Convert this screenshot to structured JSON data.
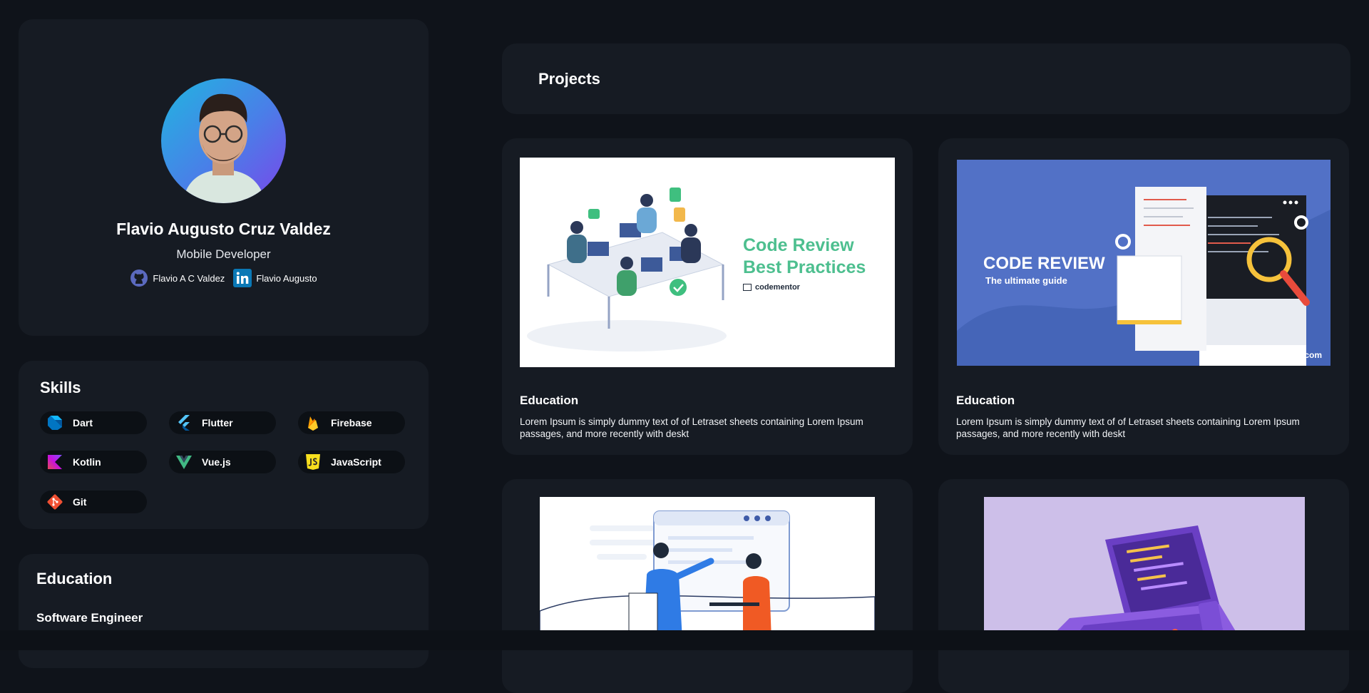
{
  "profile": {
    "name": "Flavio Augusto Cruz Valdez",
    "role": "Mobile Developer",
    "github_label": "Flavio A C Valdez",
    "linkedin_label": "Flavio Augusto"
  },
  "skills": {
    "title": "Skills",
    "items": [
      {
        "label": "Dart",
        "icon": "dart-icon"
      },
      {
        "label": "Flutter",
        "icon": "flutter-icon"
      },
      {
        "label": "Firebase",
        "icon": "firebase-icon"
      },
      {
        "label": "Kotlin",
        "icon": "kotlin-icon"
      },
      {
        "label": "Vue.js",
        "icon": "vue-icon"
      },
      {
        "label": "JavaScript",
        "icon": "javascript-icon"
      },
      {
        "label": "Git",
        "icon": "git-icon"
      }
    ]
  },
  "education": {
    "title": "Education",
    "degree": "Software Engineer"
  },
  "projects": {
    "title": "Projects",
    "items": [
      {
        "title": "Education",
        "description": "Lorem Ipsum is simply dummy text of of Letraset sheets containing Lorem Ipsum passages, and more recently with deskt",
        "thumb": {
          "heading1": "Code Review",
          "heading2": "Best Practices",
          "brand": "codementor"
        }
      },
      {
        "title": "Education",
        "description": "Lorem Ipsum is simply dummy text of of Letraset sheets containing Lorem Ipsum passages, and more recently with deskt",
        "thumb": {
          "heading": "CODE REVIEW",
          "subheading": "The ultimate guide",
          "site": "assafelovic.com"
        }
      },
      {
        "title": "",
        "description": ""
      },
      {
        "title": "",
        "description": ""
      }
    ]
  },
  "colors": {
    "background": "#0f131a",
    "card": "#161b23",
    "chip": "#0c1015",
    "accent_green": "#4dbf8f",
    "thumb_blue": "#5271c6",
    "thumb_lavender": "#cdbfe9"
  }
}
